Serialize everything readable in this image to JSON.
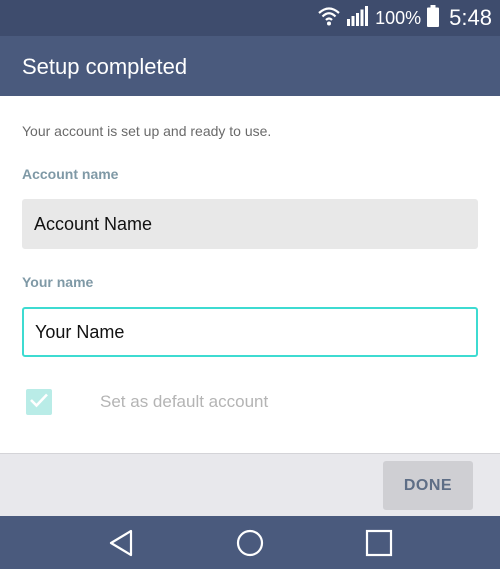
{
  "status_bar": {
    "battery_percent": "100%",
    "time": "5:48",
    "icons": [
      "wifi-icon",
      "signal-icon",
      "battery-icon"
    ]
  },
  "toolbar": {
    "title": "Setup completed"
  },
  "content": {
    "description": "Your account is set up and ready to use.",
    "account_name": {
      "label": "Account name",
      "value": "Account Name"
    },
    "your_name": {
      "label": "Your name",
      "value": "Your Name"
    },
    "default_account": {
      "label": "Set as default account",
      "checked": true
    }
  },
  "actions": {
    "done_label": "DONE"
  },
  "nav_bar": {
    "icons": [
      "back-icon",
      "home-icon",
      "recents-icon"
    ]
  },
  "colors": {
    "status_bar": "#3e4c6d",
    "toolbar": "#4a5a7d",
    "accent": "#3ddbd1",
    "label": "#7f99a6"
  }
}
